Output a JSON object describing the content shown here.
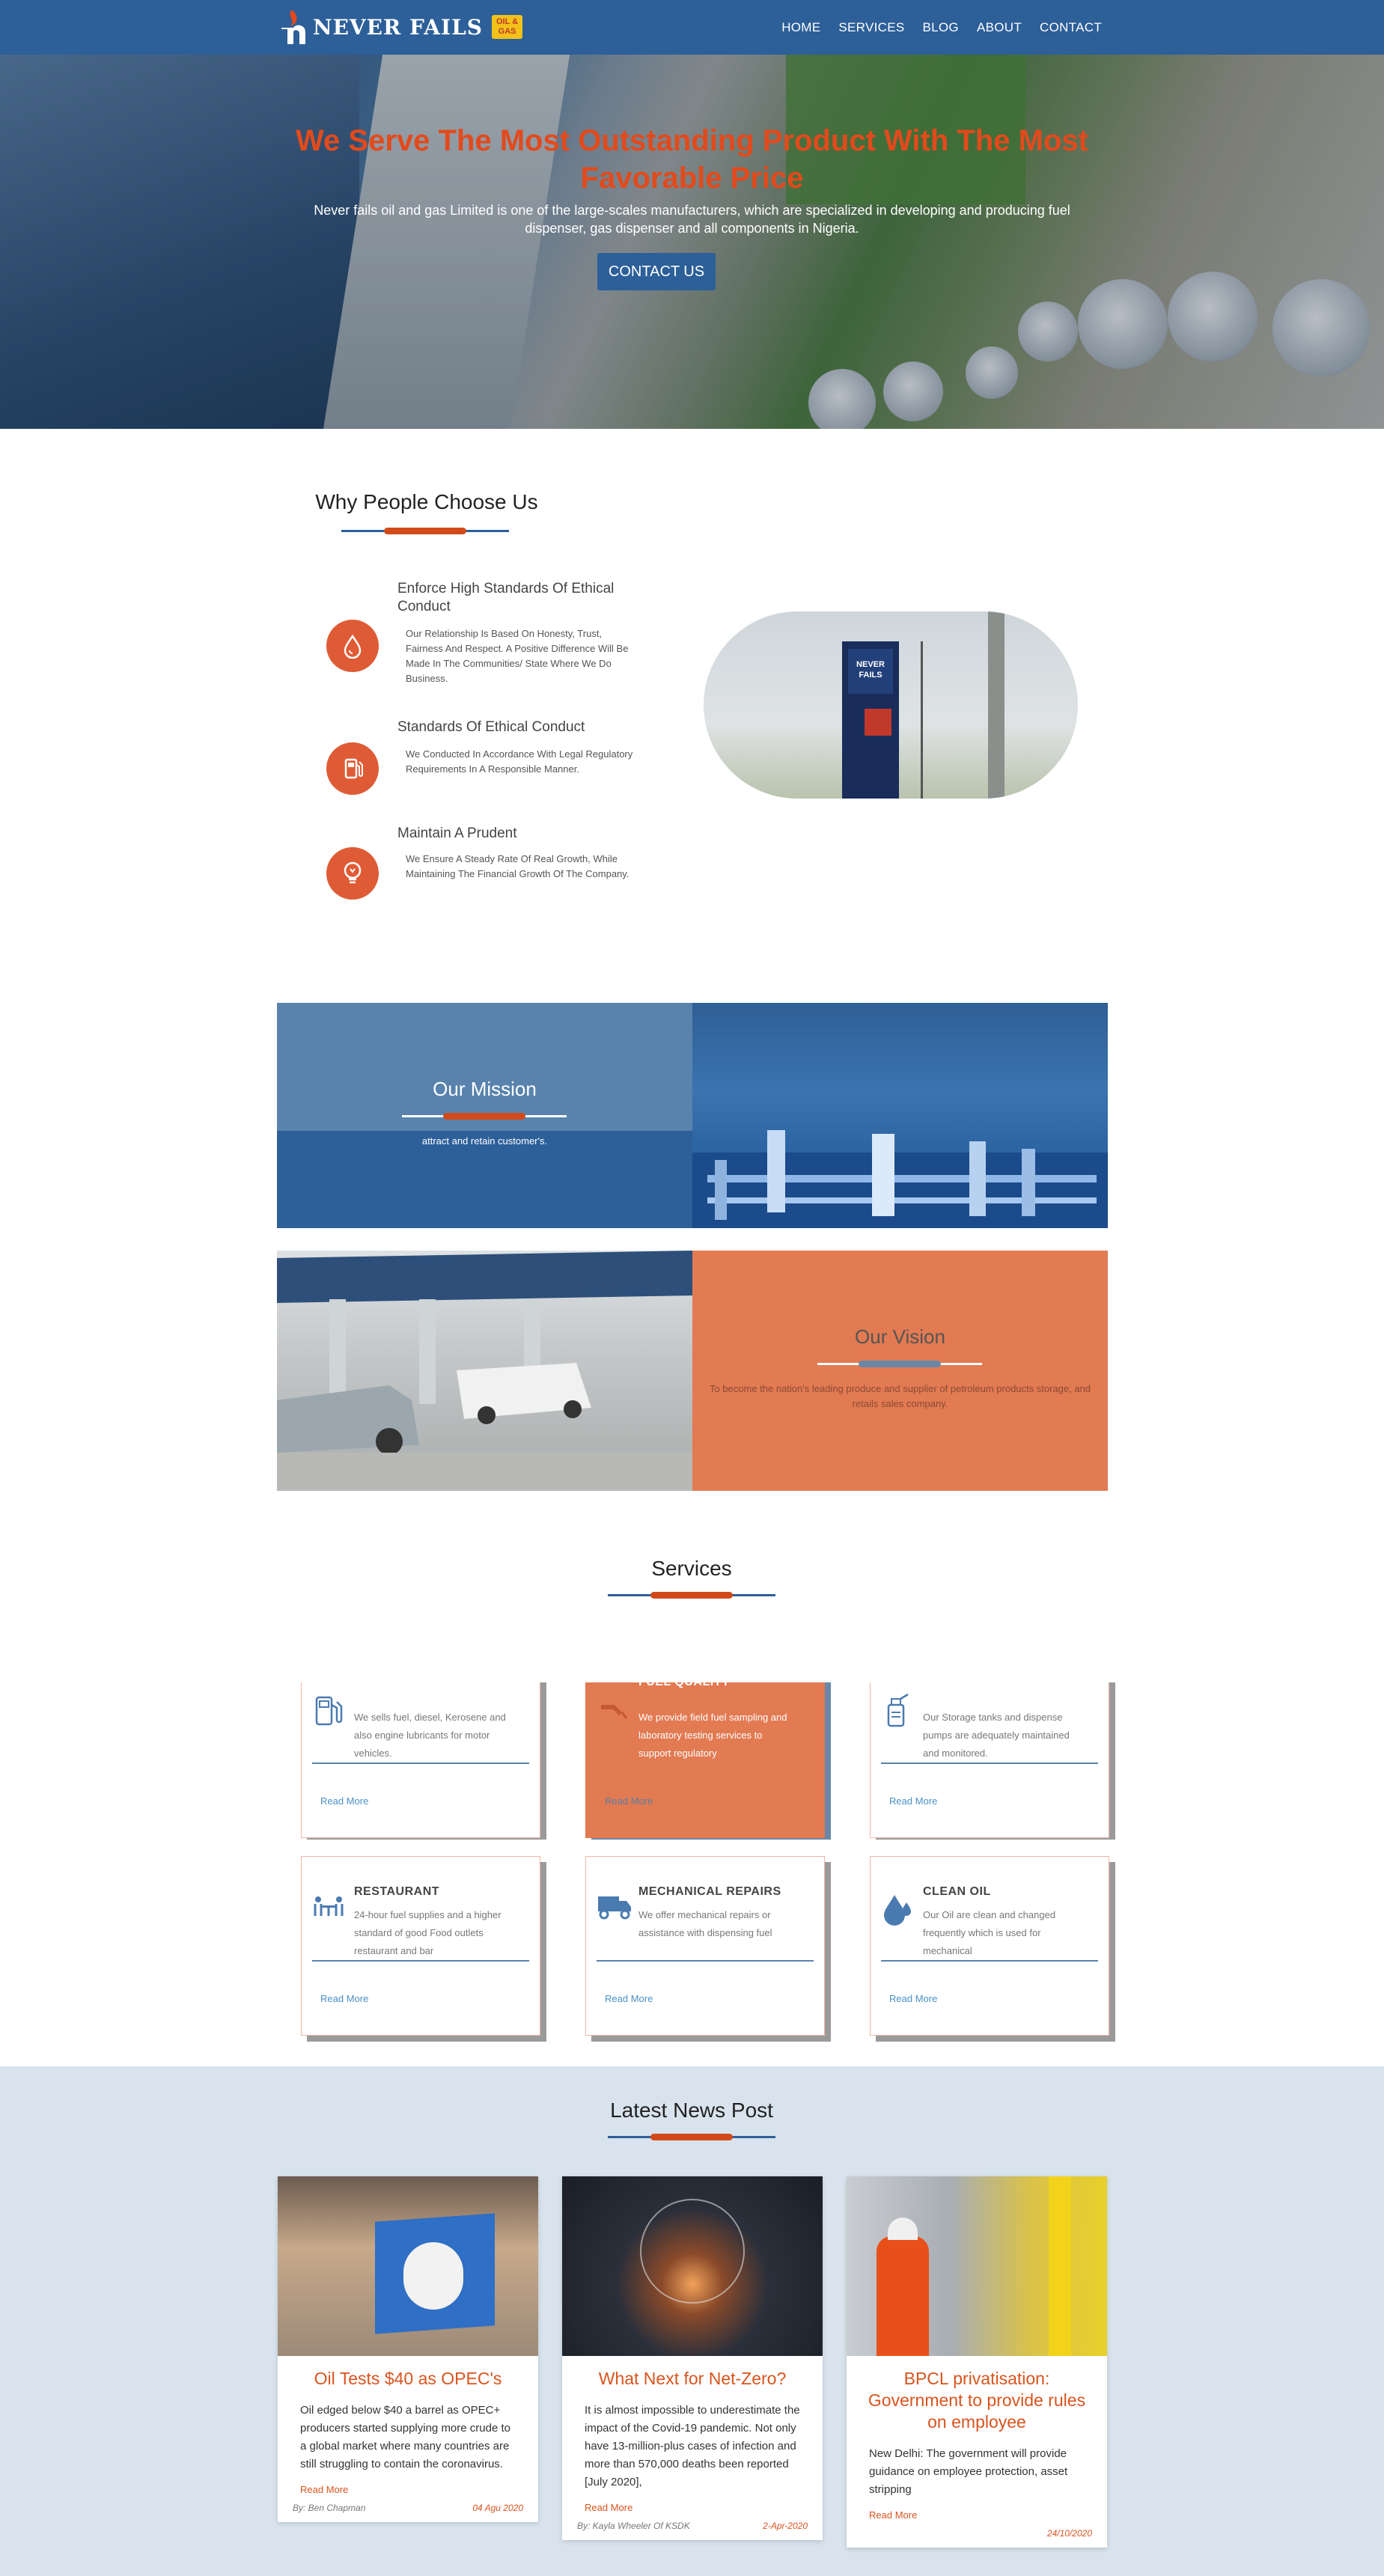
{
  "brand": {
    "name": "NEVER FAILS",
    "badge_line1": "OIL &",
    "badge_line2": "GAS"
  },
  "nav": [
    "HOME",
    "SERVICES",
    "BLOG",
    "ABOUT",
    "CONTACT"
  ],
  "hero": {
    "title": "We Serve The Most Outstanding Product With The Most Favorable Price",
    "subtitle": "Never fails oil and gas Limited is one of the large-scales manufacturers, which are specialized in developing and producing fuel dispenser, gas dispenser and all components in Nigeria.",
    "button": "CONTACT US"
  },
  "why": {
    "title": "Why People Choose Us",
    "items": [
      {
        "heading": "Enforce High Standards Of Ethical Conduct",
        "text": "Our Relationship Is Based On Honesty, Trust, Fairness And Respect. A Positive Difference Will Be Made In The Communities/ State Where We Do Business.",
        "icon": "drop-icon"
      },
      {
        "heading": "Standards Of Ethical Conduct",
        "text": "We Conducted In Accordance With Legal Regulatory Requirements In A Responsible Manner.",
        "icon": "fuel-pump-icon"
      },
      {
        "heading": "Maintain A Prudent",
        "text": "We Ensure A Steady Rate Of Real Growth, While Maintaining The Financial Growth Of The Company.",
        "icon": "bulb-icon"
      }
    ],
    "sign_text": "NEVER FAILS"
  },
  "mission": {
    "title": "Our Mission",
    "text": "attract and retain customer's."
  },
  "vision": {
    "title": "Our Vision",
    "text": "To become the nation's leading produce and supplier of petroleum products storage, and retails sales company."
  },
  "services": {
    "title": "Services",
    "row1": [
      {
        "title": "",
        "text": "We sells fuel, diesel, Kerosene and also engine lubricants for motor vehicles.",
        "more": "Read More",
        "icon": "fuel-pump-icon"
      },
      {
        "title": "FUEL QUALITY",
        "text": "We provide field fuel sampling and laboratory testing services to support regulatory",
        "more": "Read More",
        "icon": "nozzle-icon"
      },
      {
        "title": "",
        "text": "Our Storage tanks and dispense pumps are adequately maintained and monitored.",
        "more": "Read More",
        "icon": "oil-can-icon"
      }
    ],
    "row2": [
      {
        "title": "RESTAURANT",
        "text": "24-hour fuel supplies and a higher standard of good Food outlets restaurant and bar",
        "more": "Read More",
        "icon": "people-table-icon"
      },
      {
        "title": "MECHANICAL REPAIRS",
        "text": "We offer mechanical repairs or assistance with dispensing fuel",
        "more": "Read More",
        "icon": "truck-icon"
      },
      {
        "title": "CLEAN OIL",
        "text": "Our Oil are clean and changed frequently which is used for mechanical",
        "more": "Read More",
        "icon": "oil-drops-icon"
      }
    ]
  },
  "news": {
    "title": "Latest News Post",
    "cards": [
      {
        "title": "Oil Tests $40 as OPEC's",
        "text": "Oil edged below $40 a barrel as OPEC+ producers started supplying more crude to a global market where many countries are still struggling to contain the coronavirus.",
        "more": "Read More",
        "author": "By: Ben Chapman",
        "date": "04 Agu 2020"
      },
      {
        "title": "What Next for Net-Zero?",
        "text": "It is almost impossible to underestimate the impact of the Covid-19 pandemic. Not only have 13-million-plus cases of infection and more than 570,000 deaths been reported [July 2020],",
        "more": "Read More",
        "author": "By: Kayla Wheeler Of KSDK",
        "date": "2-Apr-2020"
      },
      {
        "title": "BPCL privatisation: Government to provide rules on employee",
        "text": "New Delhi: The government will provide guidance on employee protection, asset stripping",
        "more": "Read More",
        "author": "",
        "date": "24/10/2020"
      }
    ]
  },
  "colors": {
    "primary": "#2d5f99",
    "accent": "#df5b35",
    "news_bg": "#d8e3ed"
  }
}
